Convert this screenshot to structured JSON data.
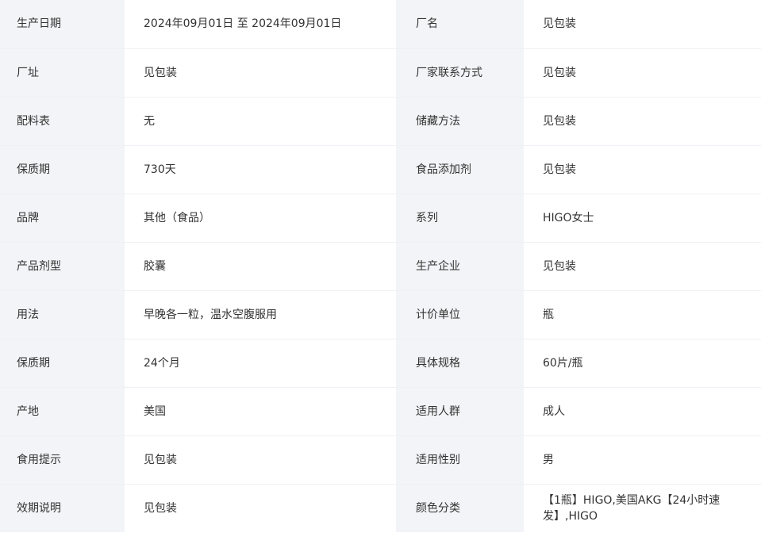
{
  "rows": [
    {
      "label_left": "生产日期",
      "value_left": "2024年09月01日 至 2024年09月01日",
      "label_right": "厂名",
      "value_right": "见包装"
    },
    {
      "label_left": "厂址",
      "value_left": "见包装",
      "label_right": "厂家联系方式",
      "value_right": "见包装"
    },
    {
      "label_left": "配料表",
      "value_left": "无",
      "label_right": "储藏方法",
      "value_right": "见包装"
    },
    {
      "label_left": "保质期",
      "value_left": "730天",
      "label_right": "食品添加剂",
      "value_right": "见包装"
    },
    {
      "label_left": "品牌",
      "value_left": "其他（食品）",
      "label_right": "系列",
      "value_right": "HIGO女士"
    },
    {
      "label_left": "产品剂型",
      "value_left": "胶囊",
      "label_right": "生产企业",
      "value_right": "见包装"
    },
    {
      "label_left": "用法",
      "value_left": "早晚各一粒，温水空腹服用",
      "label_right": "计价单位",
      "value_right": "瓶"
    },
    {
      "label_left": "保质期",
      "value_left": "24个月",
      "label_right": "具体规格",
      "value_right": "60片/瓶"
    },
    {
      "label_left": "产地",
      "value_left": "美国",
      "label_right": "适用人群",
      "value_right": "成人"
    },
    {
      "label_left": "食用提示",
      "value_left": "见包装",
      "label_right": "适用性别",
      "value_right": "男"
    },
    {
      "label_left": "效期说明",
      "value_left": "见包装",
      "label_right": "颜色分类",
      "value_right": "【1瓶】HIGO,美国AKG【24小时速发】,HIGO"
    }
  ]
}
